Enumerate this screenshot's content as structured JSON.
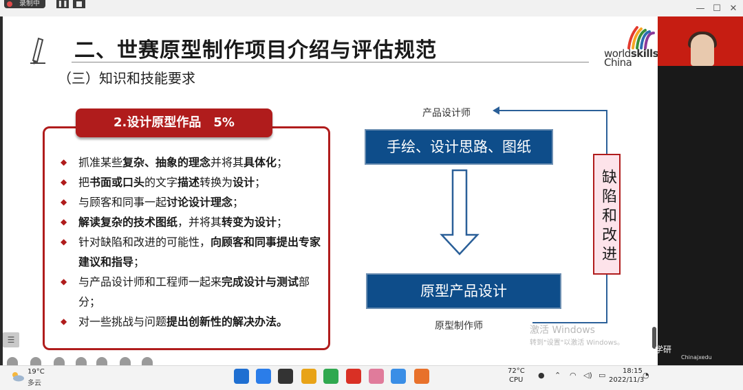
{
  "recorder": {
    "status_label": "录制中",
    "pause_glyph": "❚❚"
  },
  "window": {
    "minimize_glyph": "—",
    "maximize_glyph": "☐",
    "close_glyph": "✕"
  },
  "slide": {
    "title": "二、世赛原型制作项目介绍与评估规范",
    "subtitle": "（三）知识和技能要求",
    "logo": {
      "line1_plain": "world",
      "line1_bold": "skills",
      "line2": "China",
      "colors": [
        "#e33b2e",
        "#f6a623",
        "#3a8f3a",
        "#2b6cb0",
        "#8b3a9a"
      ]
    },
    "card": {
      "heading": "2.设计原型作品",
      "percent": "5%",
      "bullets": [
        [
          {
            "t": "抓准某些"
          },
          {
            "t": "复杂、抽象的理念",
            "b": true
          },
          {
            "t": "并将其"
          },
          {
            "t": "具体化",
            "b": true
          },
          {
            "t": "；"
          }
        ],
        [
          {
            "t": "把"
          },
          {
            "t": "书面或口头",
            "b": true
          },
          {
            "t": "的文字"
          },
          {
            "t": "描述",
            "b": true
          },
          {
            "t": "转换为"
          },
          {
            "t": "设计",
            "b": true
          },
          {
            "t": "；"
          }
        ],
        [
          {
            "t": "与顾客和同事一起"
          },
          {
            "t": "讨论设计理念",
            "b": true
          },
          {
            "t": "；"
          }
        ],
        [
          {
            "t": "解读复杂的技术图纸",
            "b": true
          },
          {
            "t": "，并将其"
          },
          {
            "t": "转变为设计",
            "b": true
          },
          {
            "t": "；"
          }
        ],
        [
          {
            "t": "针对缺陷和改进的可能性，"
          },
          {
            "t": "向顾客和同事提出专家",
            "b": true
          },
          {
            "t": "建议和指导",
            "b": true
          },
          {
            "t": "；"
          }
        ],
        [
          {
            "t": "与产品设计师和工程师一起来"
          },
          {
            "t": "完成设计与测试",
            "b": true
          },
          {
            "t": "部分；"
          }
        ],
        [
          {
            "t": "对一些挑战与问题"
          },
          {
            "t": "提出创新性的解决办法。",
            "b": true
          }
        ]
      ]
    },
    "flow": {
      "designer_label": "产品设计师",
      "step1": "手绘、设计思路、图纸",
      "step2": "原型产品设计",
      "maker_label": "原型制作师",
      "feedback": "缺陷和改进"
    },
    "activation": {
      "line1": "激活 Windows",
      "line2": "转到\"设置\"以激活 Windows。"
    },
    "menu_glyph": "☰"
  },
  "overlay": {
    "brand": "学研",
    "brand_sub": "Chinajxedu"
  },
  "taskbar": {
    "weather_temp": "19°C",
    "weather_cond": "多云",
    "cpu_temp": "72°C",
    "cpu_label": "CPU",
    "time": "18:15",
    "date": "2022/11/3",
    "app_colors": [
      "#1f6fd1",
      "#2b7de9",
      "#333333",
      "#e8a317",
      "#2fa84f",
      "#d93025",
      "#e07b9b",
      "#3a8ee6",
      "#e8712b"
    ]
  }
}
